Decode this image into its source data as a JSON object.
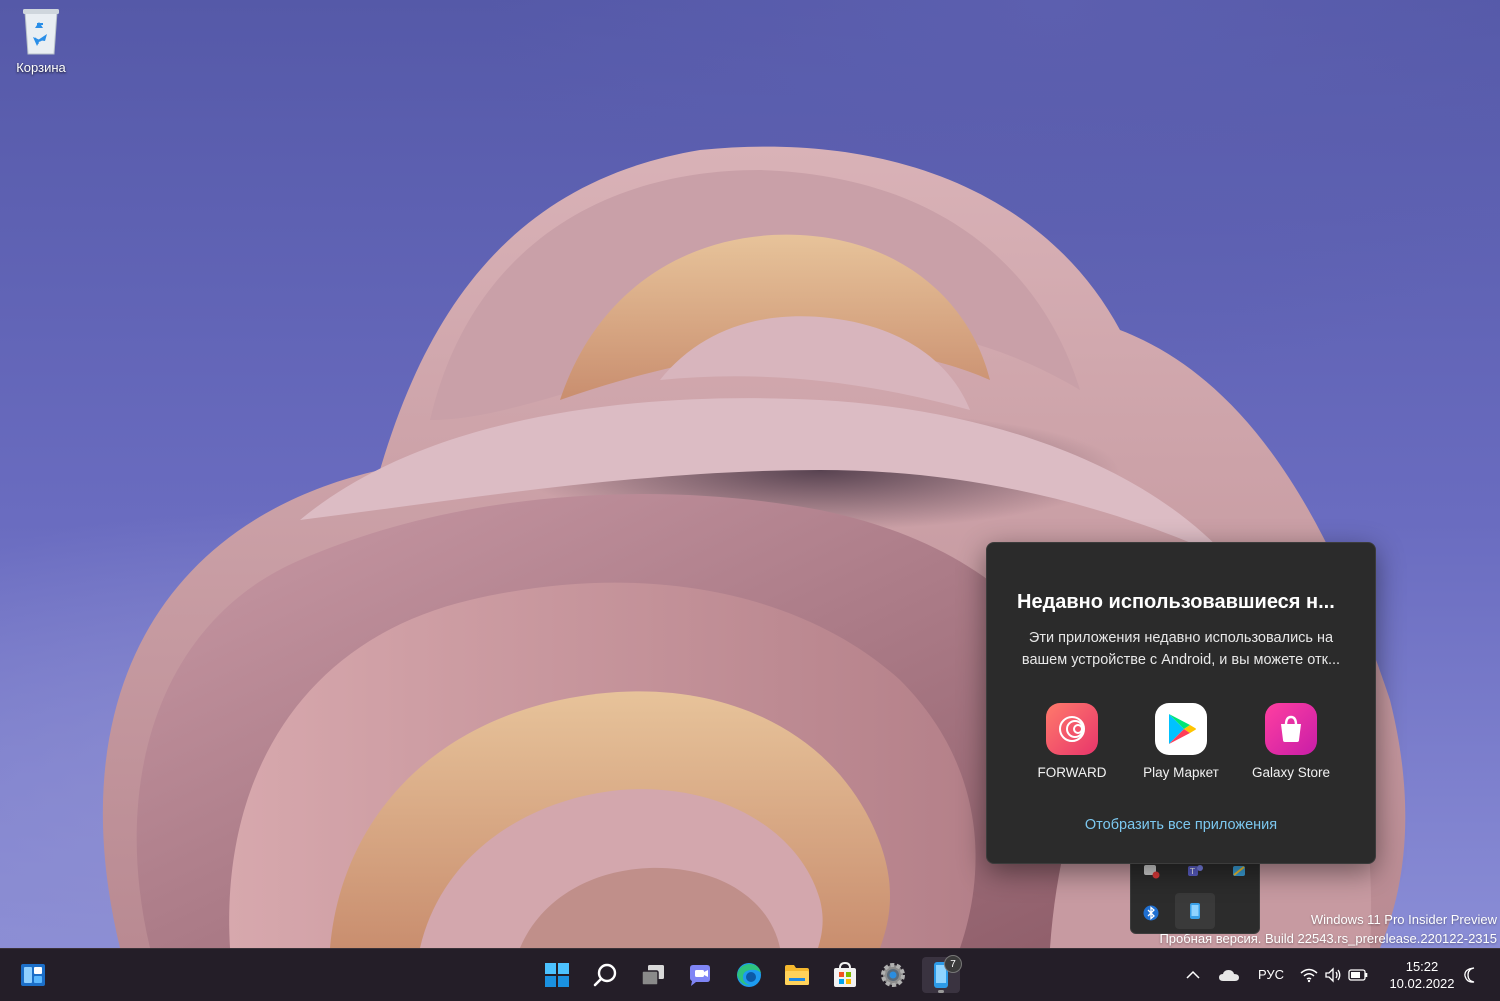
{
  "desktop": {
    "icons": [
      {
        "label": "Корзина",
        "icon": "recycle-bin-icon"
      }
    ]
  },
  "watermark": {
    "line1": "Windows 11 Pro Insider Preview",
    "line2": "Пробная версия. Build 22543.rs_prerelease.220122-2315"
  },
  "popup": {
    "title": "Недавно использовавшиеся н...",
    "desc_line1": "Эти приложения недавно использовались на",
    "desc_line2": "вашем устройстве с Android, и вы можете отк...",
    "apps": [
      {
        "label": "FORWARD",
        "icon": "forward-app-icon",
        "color": "#f25a5a"
      },
      {
        "label": "Play Маркет",
        "icon": "play-store-icon",
        "color": "#ffffff"
      },
      {
        "label": "Galaxy Store",
        "icon": "galaxy-store-icon",
        "color": "#e0247c"
      }
    ],
    "show_all": "Отобразить все приложения"
  },
  "taskbar": {
    "apps": [
      "widgets-icon",
      "start-icon",
      "search-icon",
      "task-view-icon",
      "chat-icon",
      "edge-icon",
      "file-explorer-icon",
      "store-icon",
      "settings-icon",
      "phone-link-icon"
    ],
    "phone_badge": "7",
    "language": "РУС",
    "time": "15:22",
    "date": "10.02.2022"
  },
  "colors": {
    "accent": "#7cc8f0",
    "taskbar": "#241e28",
    "popup": "#2b2b2b"
  }
}
